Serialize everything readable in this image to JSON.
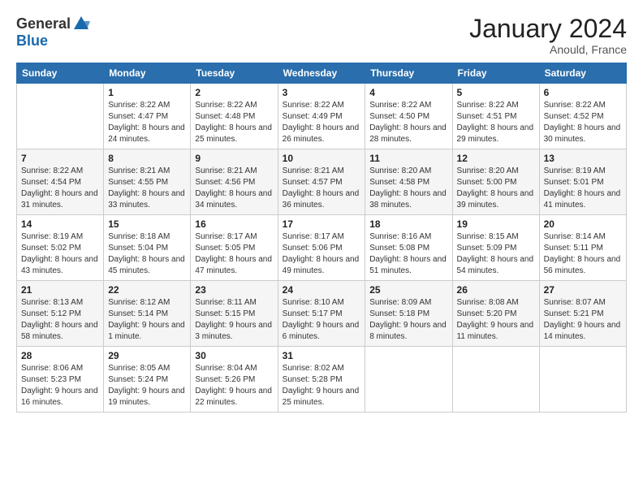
{
  "logo": {
    "general": "General",
    "blue": "Blue"
  },
  "title": "January 2024",
  "location": "Anould, France",
  "days_header": [
    "Sunday",
    "Monday",
    "Tuesday",
    "Wednesday",
    "Thursday",
    "Friday",
    "Saturday"
  ],
  "weeks": [
    [
      {
        "day": "",
        "sunrise": "",
        "sunset": "",
        "daylight": ""
      },
      {
        "day": "1",
        "sunrise": "Sunrise: 8:22 AM",
        "sunset": "Sunset: 4:47 PM",
        "daylight": "Daylight: 8 hours and 24 minutes."
      },
      {
        "day": "2",
        "sunrise": "Sunrise: 8:22 AM",
        "sunset": "Sunset: 4:48 PM",
        "daylight": "Daylight: 8 hours and 25 minutes."
      },
      {
        "day": "3",
        "sunrise": "Sunrise: 8:22 AM",
        "sunset": "Sunset: 4:49 PM",
        "daylight": "Daylight: 8 hours and 26 minutes."
      },
      {
        "day": "4",
        "sunrise": "Sunrise: 8:22 AM",
        "sunset": "Sunset: 4:50 PM",
        "daylight": "Daylight: 8 hours and 28 minutes."
      },
      {
        "day": "5",
        "sunrise": "Sunrise: 8:22 AM",
        "sunset": "Sunset: 4:51 PM",
        "daylight": "Daylight: 8 hours and 29 minutes."
      },
      {
        "day": "6",
        "sunrise": "Sunrise: 8:22 AM",
        "sunset": "Sunset: 4:52 PM",
        "daylight": "Daylight: 8 hours and 30 minutes."
      }
    ],
    [
      {
        "day": "7",
        "sunrise": "Sunrise: 8:22 AM",
        "sunset": "Sunset: 4:54 PM",
        "daylight": "Daylight: 8 hours and 31 minutes."
      },
      {
        "day": "8",
        "sunrise": "Sunrise: 8:21 AM",
        "sunset": "Sunset: 4:55 PM",
        "daylight": "Daylight: 8 hours and 33 minutes."
      },
      {
        "day": "9",
        "sunrise": "Sunrise: 8:21 AM",
        "sunset": "Sunset: 4:56 PM",
        "daylight": "Daylight: 8 hours and 34 minutes."
      },
      {
        "day": "10",
        "sunrise": "Sunrise: 8:21 AM",
        "sunset": "Sunset: 4:57 PM",
        "daylight": "Daylight: 8 hours and 36 minutes."
      },
      {
        "day": "11",
        "sunrise": "Sunrise: 8:20 AM",
        "sunset": "Sunset: 4:58 PM",
        "daylight": "Daylight: 8 hours and 38 minutes."
      },
      {
        "day": "12",
        "sunrise": "Sunrise: 8:20 AM",
        "sunset": "Sunset: 5:00 PM",
        "daylight": "Daylight: 8 hours and 39 minutes."
      },
      {
        "day": "13",
        "sunrise": "Sunrise: 8:19 AM",
        "sunset": "Sunset: 5:01 PM",
        "daylight": "Daylight: 8 hours and 41 minutes."
      }
    ],
    [
      {
        "day": "14",
        "sunrise": "Sunrise: 8:19 AM",
        "sunset": "Sunset: 5:02 PM",
        "daylight": "Daylight: 8 hours and 43 minutes."
      },
      {
        "day": "15",
        "sunrise": "Sunrise: 8:18 AM",
        "sunset": "Sunset: 5:04 PM",
        "daylight": "Daylight: 8 hours and 45 minutes."
      },
      {
        "day": "16",
        "sunrise": "Sunrise: 8:17 AM",
        "sunset": "Sunset: 5:05 PM",
        "daylight": "Daylight: 8 hours and 47 minutes."
      },
      {
        "day": "17",
        "sunrise": "Sunrise: 8:17 AM",
        "sunset": "Sunset: 5:06 PM",
        "daylight": "Daylight: 8 hours and 49 minutes."
      },
      {
        "day": "18",
        "sunrise": "Sunrise: 8:16 AM",
        "sunset": "Sunset: 5:08 PM",
        "daylight": "Daylight: 8 hours and 51 minutes."
      },
      {
        "day": "19",
        "sunrise": "Sunrise: 8:15 AM",
        "sunset": "Sunset: 5:09 PM",
        "daylight": "Daylight: 8 hours and 54 minutes."
      },
      {
        "day": "20",
        "sunrise": "Sunrise: 8:14 AM",
        "sunset": "Sunset: 5:11 PM",
        "daylight": "Daylight: 8 hours and 56 minutes."
      }
    ],
    [
      {
        "day": "21",
        "sunrise": "Sunrise: 8:13 AM",
        "sunset": "Sunset: 5:12 PM",
        "daylight": "Daylight: 8 hours and 58 minutes."
      },
      {
        "day": "22",
        "sunrise": "Sunrise: 8:12 AM",
        "sunset": "Sunset: 5:14 PM",
        "daylight": "Daylight: 9 hours and 1 minute."
      },
      {
        "day": "23",
        "sunrise": "Sunrise: 8:11 AM",
        "sunset": "Sunset: 5:15 PM",
        "daylight": "Daylight: 9 hours and 3 minutes."
      },
      {
        "day": "24",
        "sunrise": "Sunrise: 8:10 AM",
        "sunset": "Sunset: 5:17 PM",
        "daylight": "Daylight: 9 hours and 6 minutes."
      },
      {
        "day": "25",
        "sunrise": "Sunrise: 8:09 AM",
        "sunset": "Sunset: 5:18 PM",
        "daylight": "Daylight: 9 hours and 8 minutes."
      },
      {
        "day": "26",
        "sunrise": "Sunrise: 8:08 AM",
        "sunset": "Sunset: 5:20 PM",
        "daylight": "Daylight: 9 hours and 11 minutes."
      },
      {
        "day": "27",
        "sunrise": "Sunrise: 8:07 AM",
        "sunset": "Sunset: 5:21 PM",
        "daylight": "Daylight: 9 hours and 14 minutes."
      }
    ],
    [
      {
        "day": "28",
        "sunrise": "Sunrise: 8:06 AM",
        "sunset": "Sunset: 5:23 PM",
        "daylight": "Daylight: 9 hours and 16 minutes."
      },
      {
        "day": "29",
        "sunrise": "Sunrise: 8:05 AM",
        "sunset": "Sunset: 5:24 PM",
        "daylight": "Daylight: 9 hours and 19 minutes."
      },
      {
        "day": "30",
        "sunrise": "Sunrise: 8:04 AM",
        "sunset": "Sunset: 5:26 PM",
        "daylight": "Daylight: 9 hours and 22 minutes."
      },
      {
        "day": "31",
        "sunrise": "Sunrise: 8:02 AM",
        "sunset": "Sunset: 5:28 PM",
        "daylight": "Daylight: 9 hours and 25 minutes."
      },
      {
        "day": "",
        "sunrise": "",
        "sunset": "",
        "daylight": ""
      },
      {
        "day": "",
        "sunrise": "",
        "sunset": "",
        "daylight": ""
      },
      {
        "day": "",
        "sunrise": "",
        "sunset": "",
        "daylight": ""
      }
    ]
  ]
}
